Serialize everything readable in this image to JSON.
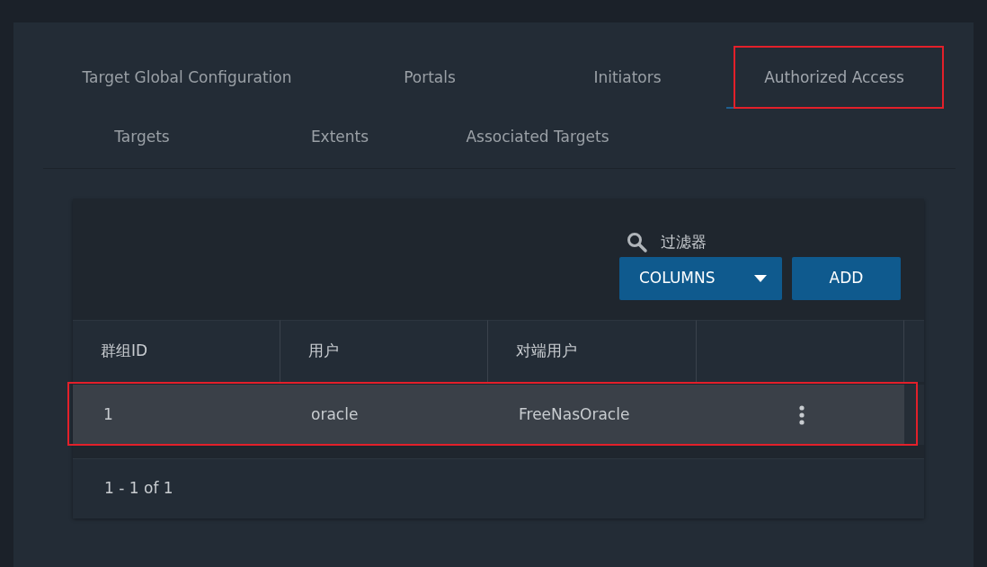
{
  "tab_rows": [
    [
      {
        "label": "Target Global Configuration",
        "selected": false,
        "highlighted": false
      },
      {
        "label": "Portals",
        "selected": false,
        "highlighted": false
      },
      {
        "label": "Initiators",
        "selected": false,
        "highlighted": false
      },
      {
        "label": "Authorized Access",
        "selected": true,
        "highlighted": true
      }
    ],
    [
      {
        "label": "Targets",
        "selected": false,
        "highlighted": false
      },
      {
        "label": "Extents",
        "selected": false,
        "highlighted": false
      },
      {
        "label": "Associated Targets",
        "selected": false,
        "highlighted": false
      }
    ]
  ],
  "toolbar": {
    "filter": {
      "placeholder": "过滤器"
    },
    "columns_button": "COLUMNS",
    "add_button": "ADD"
  },
  "table": {
    "columns": [
      "群组ID",
      "用户",
      "对端用户",
      ""
    ],
    "rows": [
      {
        "cells": [
          "1",
          "oracle",
          "FreeNasOracle"
        ],
        "highlighted": true
      }
    ],
    "pagination": "1 - 1 of 1"
  }
}
